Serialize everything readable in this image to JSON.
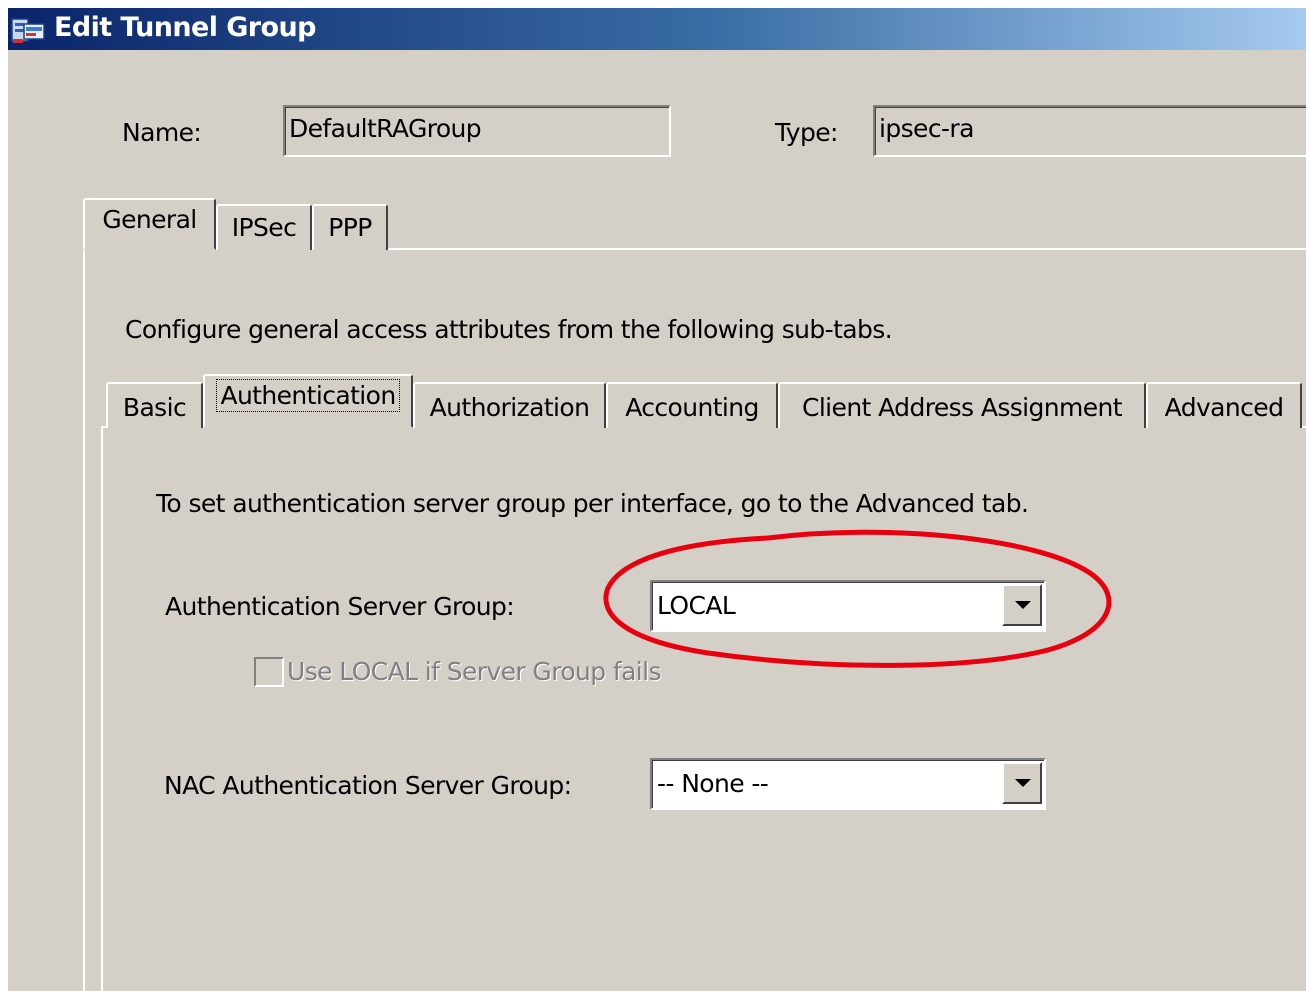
{
  "window": {
    "title": "Edit Tunnel Group",
    "title_icon": "app-window-icon"
  },
  "header": {
    "name_label": "Name:",
    "name_value": "DefaultRAGroup",
    "type_label": "Type:",
    "type_value": "ipsec-ra"
  },
  "tabs": [
    {
      "label": "General",
      "active": true
    },
    {
      "label": "IPSec",
      "active": false
    },
    {
      "label": "PPP",
      "active": false
    }
  ],
  "general": {
    "description": "Configure general access attributes from the following sub-tabs."
  },
  "subtabs": [
    {
      "label": "Basic",
      "active": false
    },
    {
      "label": "Authentication",
      "active": true
    },
    {
      "label": "Authorization",
      "active": false
    },
    {
      "label": "Accounting",
      "active": false
    },
    {
      "label": "Client Address Assignment",
      "active": false
    },
    {
      "label": "Advanced",
      "active": false
    }
  ],
  "authentication": {
    "hint": "To set authentication server group per interface, go to the Advanced tab.",
    "server_group_label": "Authentication Server Group:",
    "server_group_value": "LOCAL",
    "use_local_label": "Use LOCAL if Server Group fails",
    "use_local_checked": false,
    "use_local_enabled": false,
    "nac_label": "NAC Authentication Server Group:",
    "nac_value": "-- None --"
  },
  "colors": {
    "dialog_bg": "#d4d0c8",
    "title_gradient_start": "#0a246a",
    "title_gradient_end": "#a6caf0",
    "annotation_red": "#e8000f"
  }
}
